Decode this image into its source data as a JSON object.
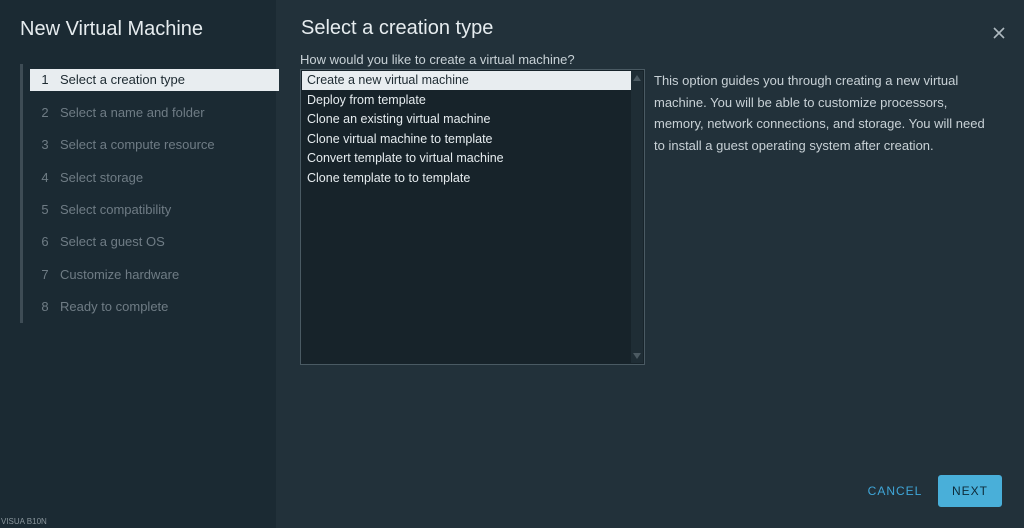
{
  "wizard": {
    "title": "New Virtual Machine"
  },
  "steps": [
    {
      "num": "1",
      "label": "Select a creation type",
      "active": true
    },
    {
      "num": "2",
      "label": "Select a name and folder"
    },
    {
      "num": "3",
      "label": "Select a compute resource"
    },
    {
      "num": "4",
      "label": "Select storage"
    },
    {
      "num": "5",
      "label": "Select compatibility"
    },
    {
      "num": "6",
      "label": "Select a guest OS"
    },
    {
      "num": "7",
      "label": "Customize hardware"
    },
    {
      "num": "8",
      "label": "Ready to complete"
    }
  ],
  "main": {
    "title": "Select a creation type",
    "question": "How would you like to create a virtual machine?",
    "options": [
      "Create a new virtual machine",
      "Deploy from template",
      "Clone an existing virtual machine",
      "Clone virtual machine to template",
      "Convert template to virtual machine",
      "Clone template to to template"
    ],
    "selected_option": "Create a new virtual machine",
    "description": "This option guides you through creating a new virtual machine. You will be able to customize processors, memory, network connections, and storage. You will need to install a guest operating system after creation."
  },
  "buttons": {
    "cancel": "CANCEL",
    "next": "NEXT"
  },
  "footer": {
    "tag": "VISUA B10N"
  },
  "icons": {
    "close": "close-icon",
    "scroll_up": "arrow-up-icon",
    "scroll_down": "arrow-down-icon"
  },
  "colors": {
    "accent": "#49afd9",
    "link": "#3fa6d8",
    "sidebar_bg": "#1b2a33",
    "main_bg": "#22313a",
    "selected_bg": "#e8edf0"
  }
}
